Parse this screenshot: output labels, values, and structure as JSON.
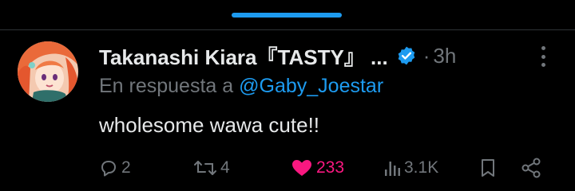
{
  "tweet": {
    "author_name": "Takanashi Kiara『TASTY』 ...",
    "separator": "·",
    "time": "3h",
    "reply_prefix": "En respuesta a ",
    "reply_handle": "@Gaby_Joestar",
    "text": "wholesome wawa cute!!",
    "verified_icon": "verified-badge-icon"
  },
  "actions": {
    "replies": "2",
    "retweets": "4",
    "likes": "233",
    "views": "3.1K"
  },
  "colors": {
    "background": "#000000",
    "text": "#e7e9ea",
    "muted": "#71767b",
    "accent": "#1d9bf0",
    "like": "#f91880"
  },
  "icons": [
    "reply-icon",
    "retweet-icon",
    "heart-icon",
    "views-icon",
    "bookmark-icon",
    "share-icon",
    "more-icon"
  ]
}
